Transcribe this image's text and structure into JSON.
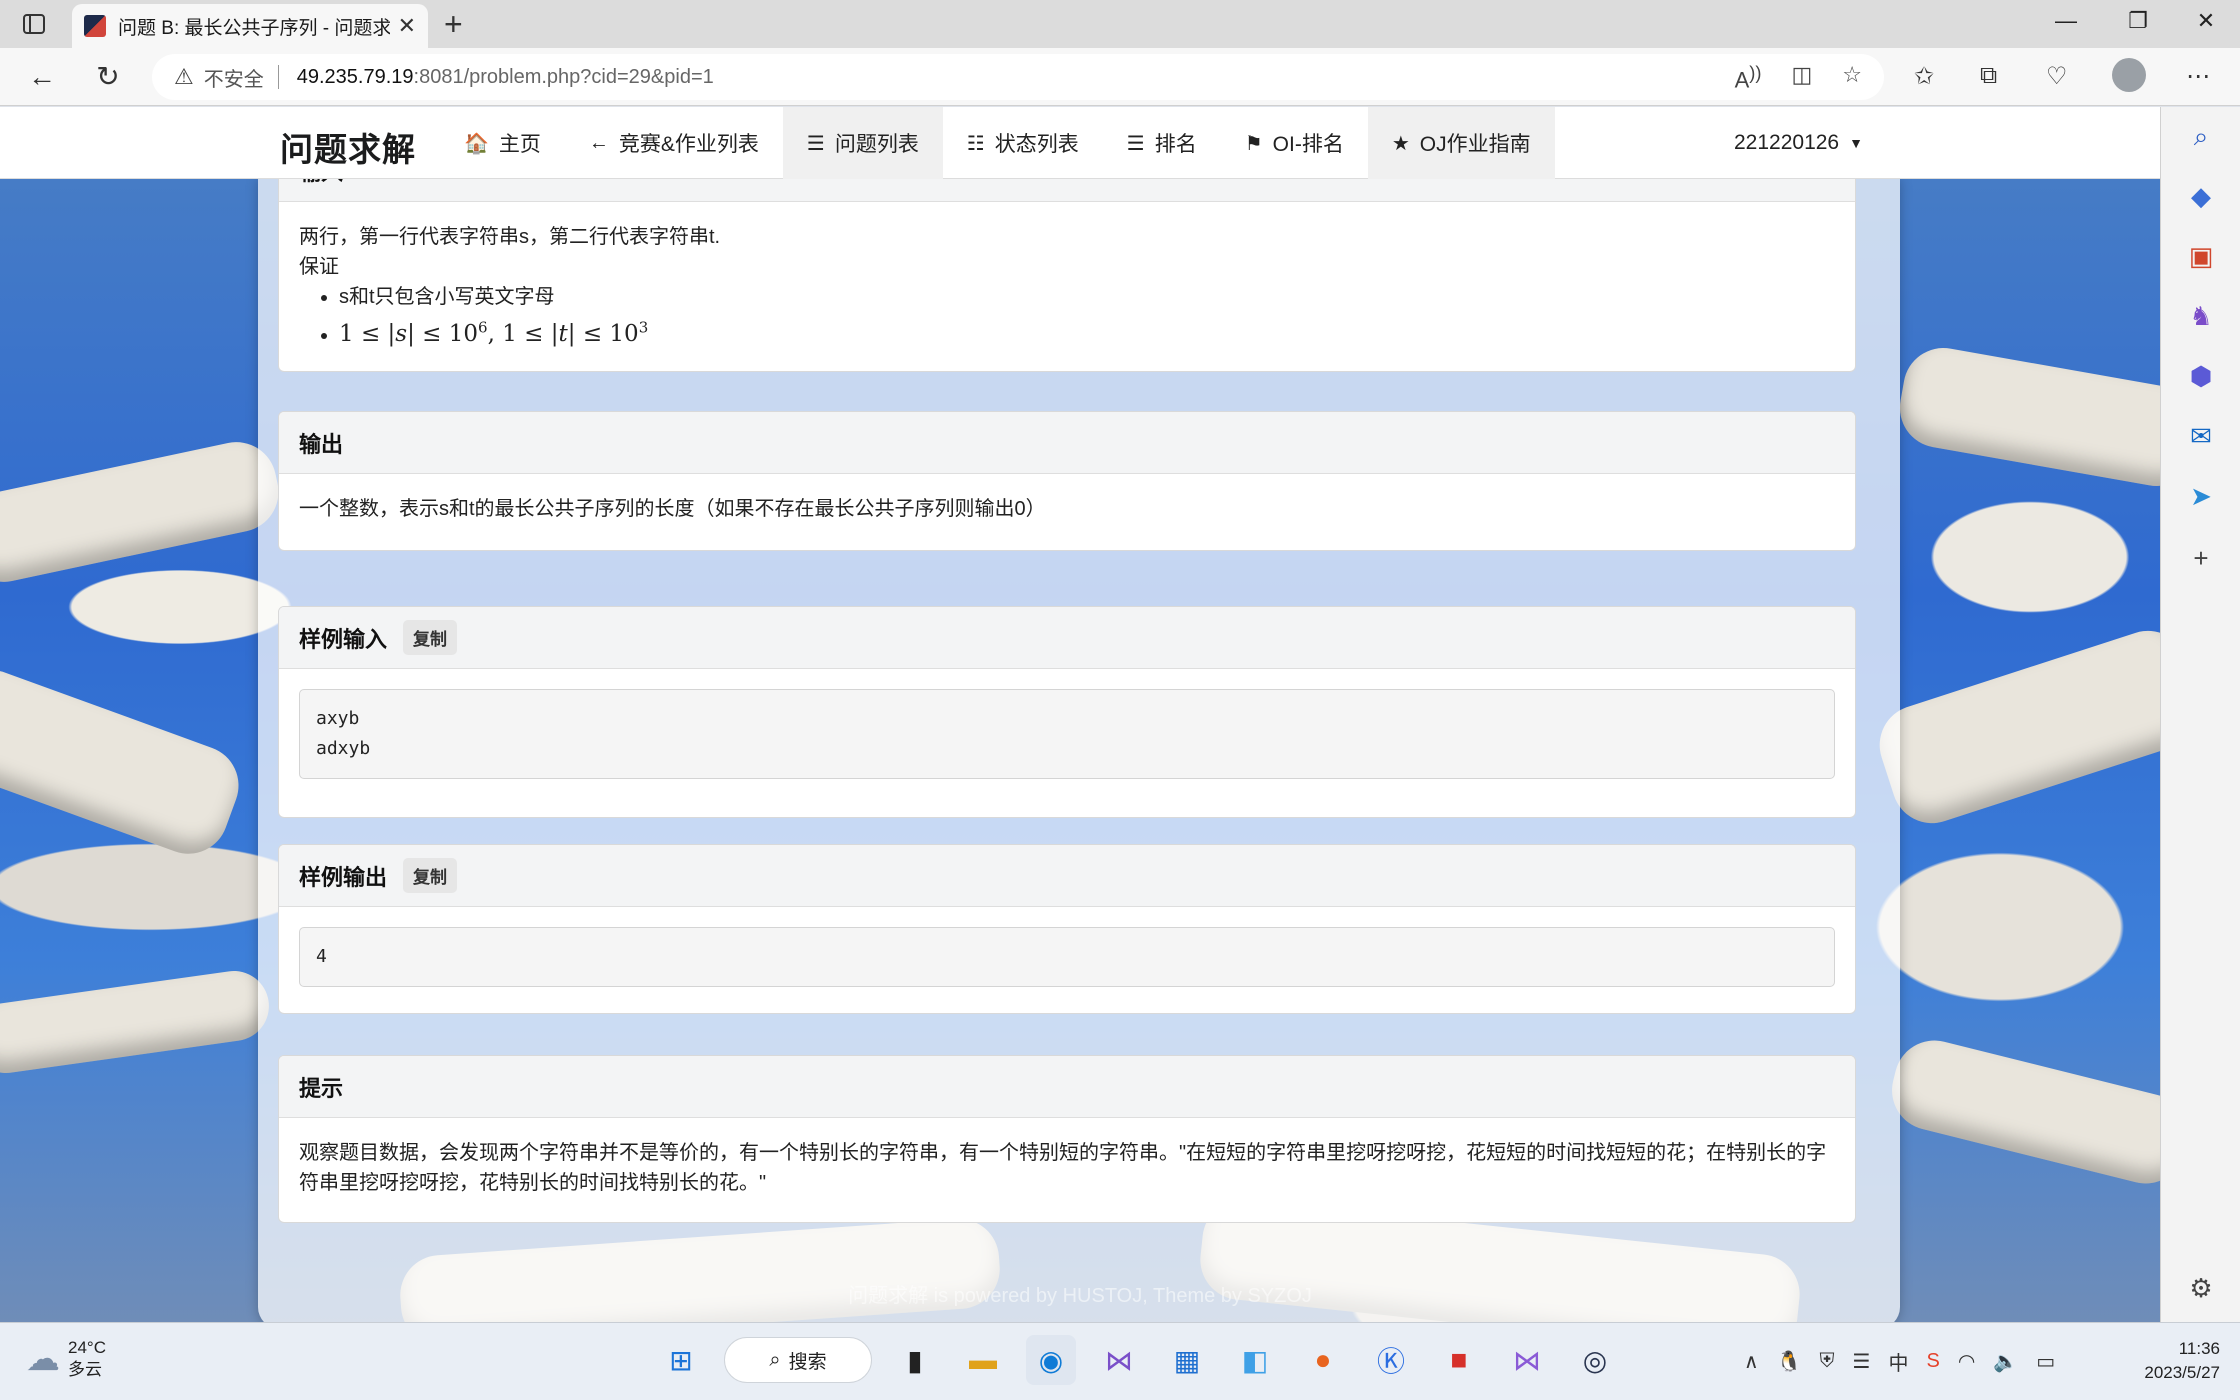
{
  "browser": {
    "tab_title": "问题 B: 最长公共子序列 - 问题求解",
    "address": {
      "security_label": "不安全",
      "host": "49.235.79.19",
      "path": ":8081/problem.php?cid=29&pid=1"
    }
  },
  "site": {
    "brand": "问题求解",
    "nav": [
      {
        "label": "主页",
        "icon": "home-icon",
        "glyph": "🏠"
      },
      {
        "label": "竞赛&作业列表",
        "icon": "arrow-left-icon",
        "glyph": "←"
      },
      {
        "label": "问题列表",
        "icon": "list-icon",
        "glyph": "☰"
      },
      {
        "label": "状态列表",
        "icon": "tasks-icon",
        "glyph": "☷"
      },
      {
        "label": "排名",
        "icon": "ordered-list-icon",
        "glyph": "☰"
      },
      {
        "label": "OI-排名",
        "icon": "trophy-icon",
        "glyph": "⚑"
      },
      {
        "label": "OJ作业指南",
        "icon": "star-icon",
        "glyph": "★"
      }
    ],
    "user": "221220126"
  },
  "problem": {
    "input": {
      "title": "输入",
      "lines": [
        "两行，第一行代表字符串s，第二行代表字符串t.",
        "保证"
      ],
      "bullets": [
        "s和t只包含小写英文字母"
      ],
      "constraint": {
        "a": "1",
        "s": "s",
        "e1": "6",
        "t": "t",
        "e2": "3",
        "base": "10"
      }
    },
    "output": {
      "title": "输出",
      "text": "一个整数，表示s和t的最长公共子序列的长度（如果不存在最长公共子序列则输出0）"
    },
    "sample_input": {
      "title": "样例输入",
      "copy": "复制",
      "code": "axyb\nadxyb"
    },
    "sample_output": {
      "title": "样例输出",
      "copy": "复制",
      "code": "4"
    },
    "hint": {
      "title": "提示",
      "text": "观察题目数据，会发现两个字符串并不是等价的，有一个特别长的字符串，有一个特别短的字符串。\"在短短的字符串里挖呀挖呀挖，花短短的时间找短短的花；在特别长的字符串里挖呀挖呀挖，花特别长的时间找特别长的花。\""
    }
  },
  "footer": "问题求解 is powered by HUSTOJ, Theme by SYZOJ",
  "taskbar": {
    "weather_temp": "24°C",
    "weather_desc": "多云",
    "search_label": "搜索",
    "time": "11:36",
    "date": "2023/5/27",
    "ime": "中"
  }
}
